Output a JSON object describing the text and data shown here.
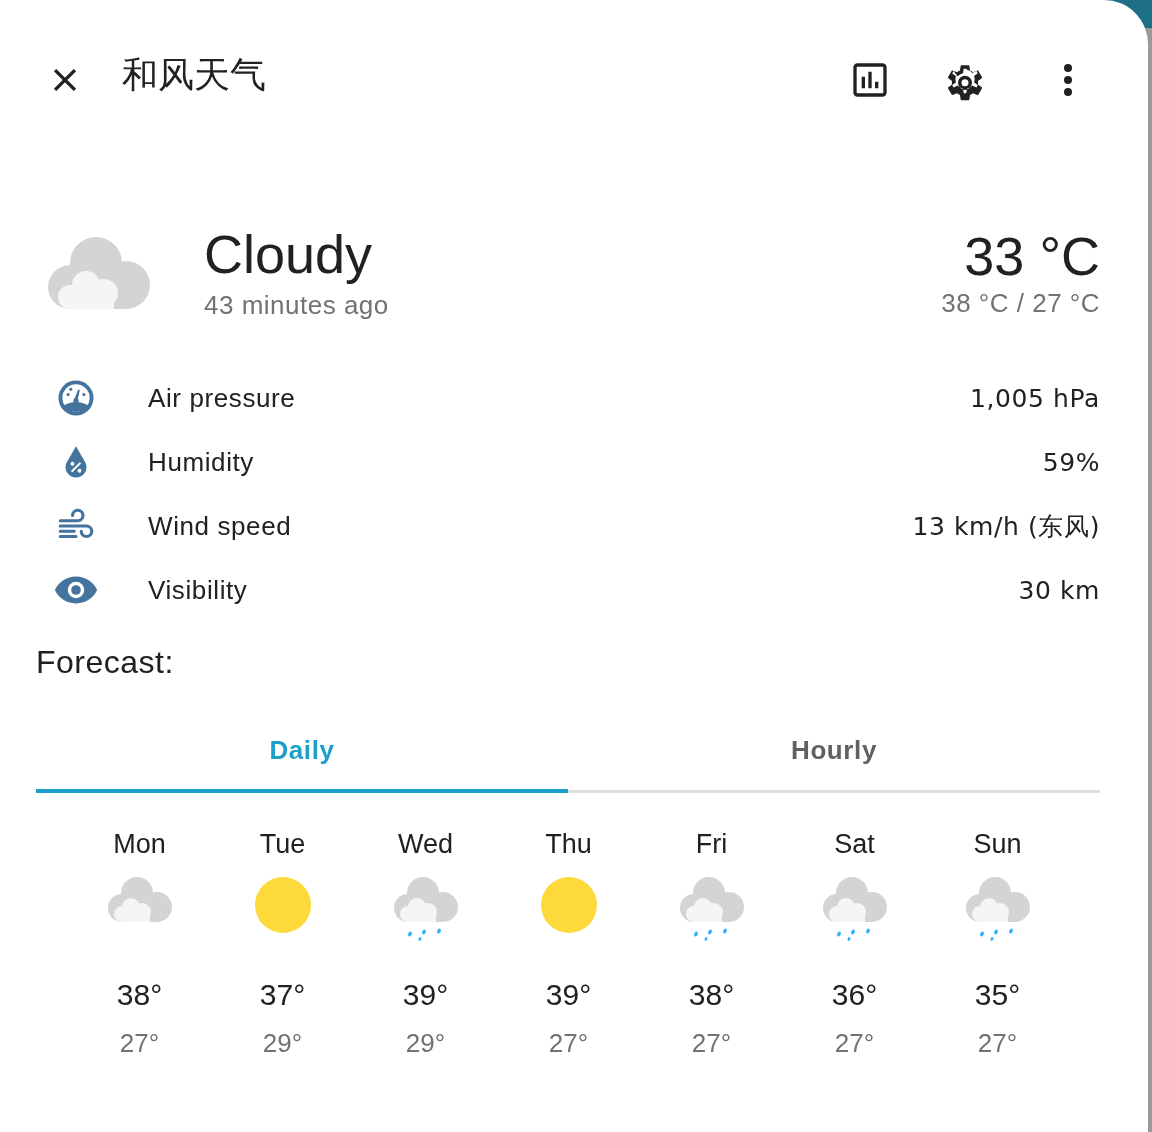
{
  "dialog": {
    "title": "和风天气"
  },
  "current": {
    "kind": "cloudy",
    "condition": "Cloudy",
    "updated": "43 minutes ago",
    "temperature": "33 °C",
    "range": "38 °C / 27 °C"
  },
  "attributes": [
    {
      "kind": "pressure",
      "label": "Air pressure",
      "value": "1,005 hPa"
    },
    {
      "kind": "humidity",
      "label": "Humidity",
      "value": "59%"
    },
    {
      "kind": "wind",
      "label": "Wind speed",
      "value": "13 km/h (东风)"
    },
    {
      "kind": "visibility",
      "label": "Visibility",
      "value": "30 km"
    }
  ],
  "forecast_heading": "Forecast:",
  "tabs": [
    {
      "label": "Daily",
      "selected": true
    },
    {
      "label": "Hourly",
      "selected": false
    }
  ],
  "forecast": [
    {
      "day": "Mon",
      "kind": "cloudy",
      "high": "38°",
      "low": "27°"
    },
    {
      "day": "Tue",
      "kind": "sunny",
      "high": "37°",
      "low": "29°"
    },
    {
      "day": "Wed",
      "kind": "rainy",
      "high": "39°",
      "low": "29°"
    },
    {
      "day": "Thu",
      "kind": "sunny",
      "high": "39°",
      "low": "27°"
    },
    {
      "day": "Fri",
      "kind": "rainy",
      "high": "38°",
      "low": "27°"
    },
    {
      "day": "Sat",
      "kind": "rainy",
      "high": "36°",
      "low": "27°"
    },
    {
      "day": "Sun",
      "kind": "rainy",
      "high": "35°",
      "low": "27°"
    }
  ]
}
